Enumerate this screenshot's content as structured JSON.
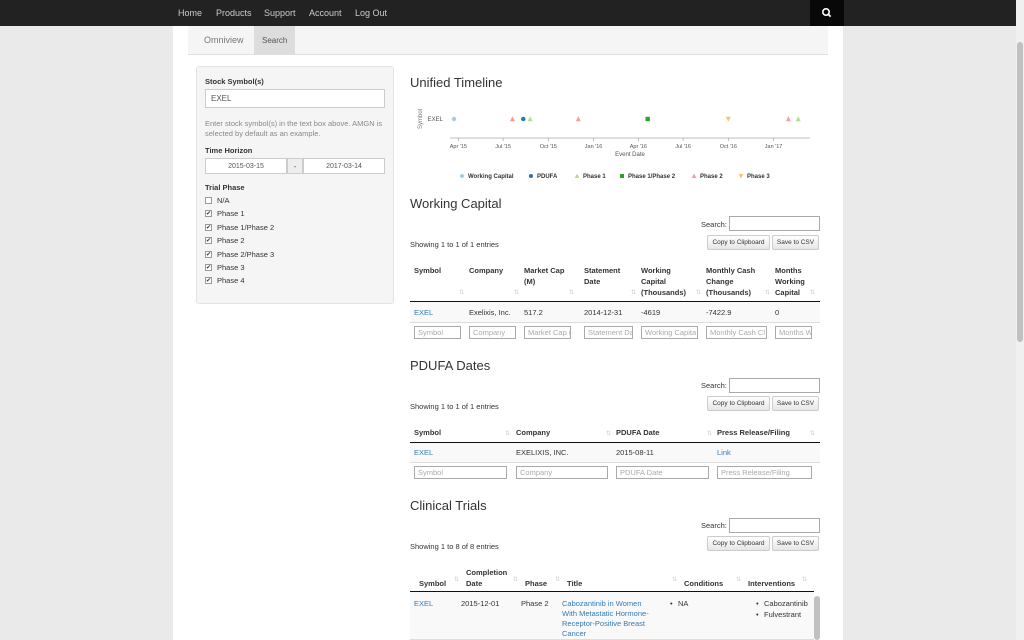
{
  "nav": {
    "items": [
      "Home",
      "Products",
      "Support",
      "Account",
      "Log Out"
    ]
  },
  "tabs": [
    "Omniview",
    "Search"
  ],
  "sidebar": {
    "symbol_label": "Stock Symbol(s)",
    "symbol_value": "EXEL",
    "help_text": "Enter stock symbol(s) in the text box above. AMGN is selected by default as an example.",
    "time_horizon_label": "Time Horizon",
    "start_date": "2015-03-15",
    "sep": "-",
    "end_date": "2017-03-14",
    "trial_phase_label": "Trial Phase",
    "phases": [
      {
        "label": "N/A",
        "checked": false
      },
      {
        "label": "Phase 1",
        "checked": true
      },
      {
        "label": "Phase 1/Phase 2",
        "checked": true
      },
      {
        "label": "Phase 2",
        "checked": true
      },
      {
        "label": "Phase 2/Phase 3",
        "checked": true
      },
      {
        "label": "Phase 3",
        "checked": true
      },
      {
        "label": "Phase 4",
        "checked": true
      }
    ]
  },
  "timeline": {
    "title": "Unified Timeline",
    "ylabel": "Symbol",
    "xlabel": "Event Date"
  },
  "chart_data": {
    "type": "scatter",
    "title": "Unified Timeline",
    "xlabel": "Event Date",
    "ylabel": "Symbol",
    "categories": [
      "EXEL"
    ],
    "x_ticks": [
      "Apr '15",
      "Jul '15",
      "Oct '15",
      "Jan '16",
      "Apr '16",
      "Jul '16",
      "Oct '16",
      "Jan '17"
    ],
    "xlim": [
      "2015-03-15",
      "2017-03-14"
    ],
    "legend_position": "bottom",
    "series": [
      {
        "name": "Working Capital",
        "color": "#a6cee3",
        "marker": "circle",
        "points": [
          {
            "x": "2014-12-31",
            "y": "EXEL"
          }
        ]
      },
      {
        "name": "PDUFA",
        "color": "#1f78b4",
        "marker": "circle",
        "points": [
          {
            "x": "2015-08-11",
            "y": "EXEL"
          }
        ]
      },
      {
        "name": "Phase 1",
        "color": "#b2df8a",
        "marker": "triangle-up",
        "points": [
          {
            "x": "2015-08-25",
            "y": "EXEL"
          },
          {
            "x": "2017-02-20",
            "y": "EXEL"
          }
        ]
      },
      {
        "name": "Phase 1/Phase 2",
        "color": "#33a02c",
        "marker": "square",
        "points": [
          {
            "x": "2016-04-20",
            "y": "EXEL"
          }
        ]
      },
      {
        "name": "Phase 2",
        "color": "#fb9a99",
        "marker": "triangle-up",
        "points": [
          {
            "x": "2015-07-20",
            "y": "EXEL"
          },
          {
            "x": "2015-12-01",
            "y": "EXEL"
          },
          {
            "x": "2017-01-31",
            "y": "EXEL"
          }
        ]
      },
      {
        "name": "Phase 3",
        "color": "#fdbf6f",
        "marker": "triangle-down",
        "points": [
          {
            "x": "2016-10-01",
            "y": "EXEL"
          }
        ]
      }
    ]
  },
  "working_capital": {
    "title": "Working Capital",
    "search_label": "Search:",
    "info": "Showing 1 to 1 of 1 entries",
    "copy_btn": "Copy to Clipboard",
    "csv_btn": "Save to CSV",
    "columns": [
      "Symbol",
      "Company",
      "Market Cap (M)",
      "Statement Date",
      "Working Capital (Thousands)",
      "Monthly Cash Change (Thousands)",
      "Months Working Capital"
    ],
    "row": [
      "EXEL",
      "Exelixis, Inc.",
      "517.2",
      "2014-12-31",
      "-4619",
      "-7422.9",
      "0"
    ],
    "filters": [
      "Symbol",
      "Company",
      "Market Cap (",
      "Statement Da",
      "Working Capita",
      "Monthly Cash Cl",
      "Months Wor"
    ]
  },
  "pdufa": {
    "title": "PDUFA Dates",
    "search_label": "Search:",
    "info": "Showing 1 to 1 of 1 entries",
    "copy_btn": "Copy to Clipboard",
    "csv_btn": "Save to CSV",
    "columns": [
      "Symbol",
      "Company",
      "PDUFA Date",
      "Press Release/Filing"
    ],
    "row": [
      "EXEL",
      "EXELIXIS, INC.",
      "2015-08-11",
      "Link"
    ],
    "filters": [
      "Symbol",
      "Company",
      "PDUFA Date",
      "Press Release/Filing"
    ]
  },
  "trials": {
    "title": "Clinical Trials",
    "search_label": "Search:",
    "info": "Showing 1 to 8 of 8 entries",
    "copy_btn": "Copy to Clipboard",
    "csv_btn": "Save to CSV",
    "columns": [
      "Symbol",
      "Completion Date",
      "Phase",
      "Title",
      "Conditions",
      "Interventions"
    ],
    "row": {
      "symbol": "EXEL",
      "date": "2015-12-01",
      "phase": "Phase 2",
      "title": "Cabozantinib in Women With Metastatic Hormone-Receptor-Positive Breast Cancer",
      "conditions": [
        "NA"
      ],
      "interventions": [
        "Cabozantinib",
        "Fulvestrant"
      ]
    }
  }
}
